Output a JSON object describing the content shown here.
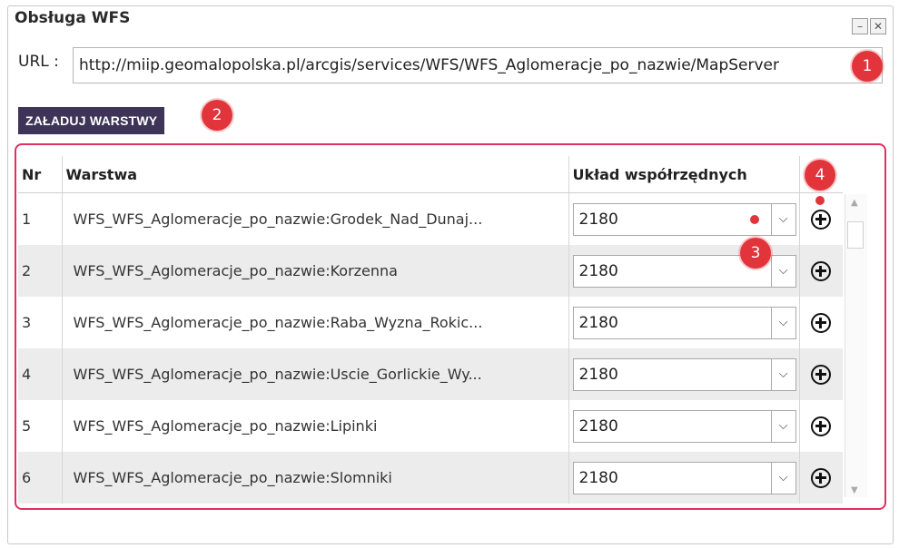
{
  "window": {
    "title": "Obsługa WFS",
    "minimize_glyph": "–",
    "close_glyph": "✕"
  },
  "url": {
    "label": "URL :",
    "value": "http://miip.geomalopolska.pl/arcgis/services/WFS/WFS_Aglomeracje_po_nazwie/MapServer"
  },
  "load_button_label": "ZAŁADUJ WARSTWY",
  "badges": [
    "1",
    "2",
    "3",
    "4"
  ],
  "table": {
    "headers": {
      "nr": "Nr",
      "layer": "Warstwa",
      "crs": "Układ współrzędnych"
    },
    "rows": [
      {
        "nr": "1",
        "layer": "WFS_WFS_Aglomeracje_po_nazwie:Grodek_Nad_Dunaj...",
        "crs": "2180"
      },
      {
        "nr": "2",
        "layer": "WFS_WFS_Aglomeracje_po_nazwie:Korzenna",
        "crs": "2180"
      },
      {
        "nr": "3",
        "layer": "WFS_WFS_Aglomeracje_po_nazwie:Raba_Wyzna_Rokic...",
        "crs": "2180"
      },
      {
        "nr": "4",
        "layer": "WFS_WFS_Aglomeracje_po_nazwie:Uscie_Gorlickie_Wy...",
        "crs": "2180"
      },
      {
        "nr": "5",
        "layer": "WFS_WFS_Aglomeracje_po_nazwie:Lipinki",
        "crs": "2180"
      },
      {
        "nr": "6",
        "layer": "WFS_WFS_Aglomeracje_po_nazwie:Slomniki",
        "crs": "2180"
      }
    ]
  },
  "icons": {
    "add": "plus-circle-icon",
    "dropdown": "chevron-down-icon"
  },
  "colors": {
    "button_bg": "#3d3457",
    "badge": "#e2343b",
    "highlight_frame": "#e0305f",
    "alt_row": "#ececec"
  }
}
